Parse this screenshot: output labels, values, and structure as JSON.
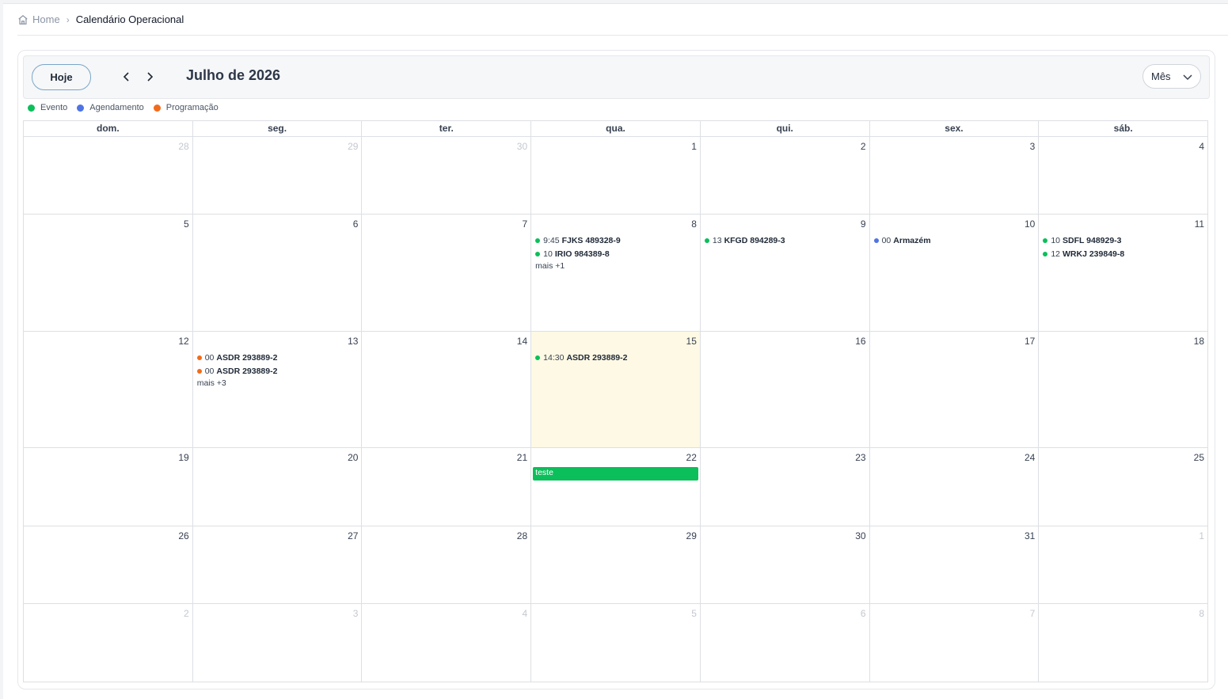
{
  "breadcrumb": {
    "home": "Home",
    "current": "Calendário Operacional"
  },
  "toolbar": {
    "today_label": "Hoje",
    "title": "Julho de 2026",
    "view_selected": "Mês"
  },
  "legend": [
    {
      "label": "Evento",
      "color": "#0bbf5a"
    },
    {
      "label": "Agendamento",
      "color": "#4f74e3"
    },
    {
      "label": "Programação",
      "color": "#f26b1d"
    }
  ],
  "weekdays": [
    "dom.",
    "seg.",
    "ter.",
    "qua.",
    "qui.",
    "sex.",
    "sáb."
  ],
  "weeks": [
    [
      {
        "n": "28",
        "other": true
      },
      {
        "n": "29",
        "other": true
      },
      {
        "n": "30",
        "other": true
      },
      {
        "n": "1"
      },
      {
        "n": "2"
      },
      {
        "n": "3"
      },
      {
        "n": "4"
      }
    ],
    [
      {
        "n": "5"
      },
      {
        "n": "6"
      },
      {
        "n": "7"
      },
      {
        "n": "8",
        "events": [
          {
            "time": "9:45",
            "title": "FJKS 489328-9",
            "color": "#0bbf5a"
          },
          {
            "time": "10",
            "title": "IRIO 984389-8",
            "color": "#0bbf5a"
          }
        ],
        "more": "mais +1"
      },
      {
        "n": "9",
        "events": [
          {
            "time": "13",
            "title": "KFGD 894289-3",
            "color": "#0bbf5a"
          }
        ]
      },
      {
        "n": "10",
        "events": [
          {
            "time": "00",
            "title": "Armazém",
            "color": "#4f74e3"
          }
        ]
      },
      {
        "n": "11",
        "events": [
          {
            "time": "10",
            "title": "SDFL 948929-3",
            "color": "#0bbf5a"
          },
          {
            "time": "12",
            "title": "WRKJ 239849-8",
            "color": "#0bbf5a"
          }
        ]
      }
    ],
    [
      {
        "n": "12"
      },
      {
        "n": "13",
        "events": [
          {
            "time": "00",
            "title": "ASDR 293889-2",
            "color": "#f26b1d"
          },
          {
            "time": "00",
            "title": "ASDR 293889-2",
            "color": "#f26b1d"
          }
        ],
        "more": "mais +3"
      },
      {
        "n": "14"
      },
      {
        "n": "15",
        "today": true,
        "events": [
          {
            "time": "14:30",
            "title": "ASDR 293889-2",
            "color": "#0bbf5a"
          }
        ]
      },
      {
        "n": "16"
      },
      {
        "n": "17"
      },
      {
        "n": "18"
      }
    ],
    [
      {
        "n": "19"
      },
      {
        "n": "20"
      },
      {
        "n": "21"
      },
      {
        "n": "22",
        "bar": "teste"
      },
      {
        "n": "23"
      },
      {
        "n": "24"
      },
      {
        "n": "25"
      }
    ],
    [
      {
        "n": "26"
      },
      {
        "n": "27"
      },
      {
        "n": "28"
      },
      {
        "n": "29"
      },
      {
        "n": "30"
      },
      {
        "n": "31"
      },
      {
        "n": "1",
        "other": true
      }
    ],
    [
      {
        "n": "2",
        "other": true
      },
      {
        "n": "3",
        "other": true
      },
      {
        "n": "4",
        "other": true
      },
      {
        "n": "5",
        "other": true
      },
      {
        "n": "6",
        "other": true
      },
      {
        "n": "7",
        "other": true
      },
      {
        "n": "8",
        "other": true
      }
    ]
  ]
}
